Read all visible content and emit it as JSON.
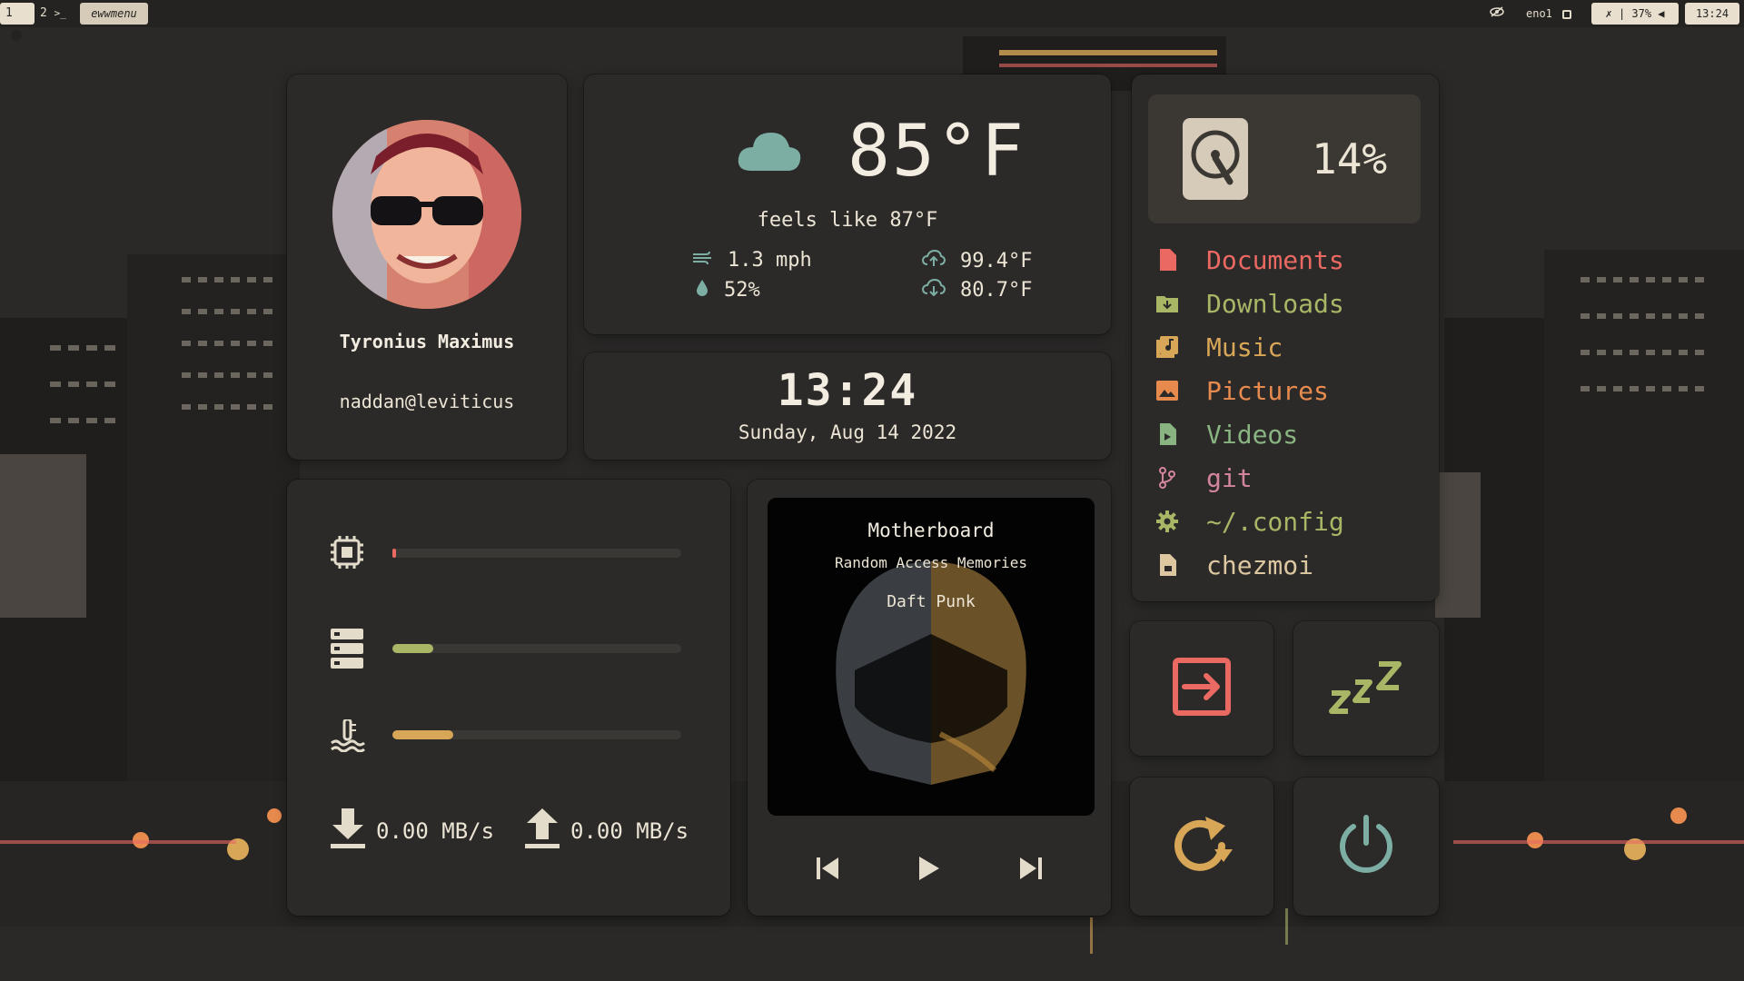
{
  "topbar": {
    "workspace_1": "1",
    "workspace_2": "2",
    "workspace_2_glyph": ">_",
    "launcher": "ewwmenu",
    "network": "eno1",
    "status": "| 37% ",
    "clock": "13:24"
  },
  "profile": {
    "name": "Tyronius Maximus",
    "handle": "naddan@leviticus"
  },
  "weather": {
    "temperature": "85°F",
    "feels_like": "feels like 87°F",
    "wind": "1.3 mph",
    "humidity": "52%",
    "high": "99.4°F",
    "low": "80.7°F"
  },
  "clock": {
    "time": "13:24",
    "date": "Sunday, Aug 14 2022"
  },
  "disk": {
    "usage": "14%"
  },
  "files": [
    {
      "label": "Documents",
      "color": "#ea6962",
      "icon": "document-icon"
    },
    {
      "label": "Downloads",
      "color": "#a9b665",
      "icon": "folder-download-icon"
    },
    {
      "label": "Music",
      "color": "#d8a657",
      "icon": "music-icon"
    },
    {
      "label": "Pictures",
      "color": "#e78a4e",
      "icon": "image-icon"
    },
    {
      "label": "Videos",
      "color": "#89b482",
      "icon": "video-file-icon"
    },
    {
      "label": "git",
      "color": "#d3869b",
      "icon": "git-branch-icon"
    },
    {
      "label": "~/.config",
      "color": "#a9b665",
      "icon": "gear-icon"
    },
    {
      "label": "chezmoi",
      "color": "#ddc7a1",
      "icon": "file-icon"
    }
  ],
  "system": {
    "cpu": {
      "level": 0.01,
      "color": "#ea6962"
    },
    "memory": {
      "level": 0.14,
      "color": "#a9b665"
    },
    "temperature": {
      "level": 0.21,
      "color": "#d8a657"
    },
    "download": "0.00 MB/s",
    "upload": "0.00 MB/s"
  },
  "music": {
    "title": "Motherboard",
    "album": "Random Access Memories",
    "artist": "Daft Punk"
  },
  "colors": {
    "logout": "#ea6962",
    "sleep": "#a9b665",
    "reboot": "#d8a657",
    "power": "#7daea3",
    "weather_icon": "#7daea3"
  }
}
